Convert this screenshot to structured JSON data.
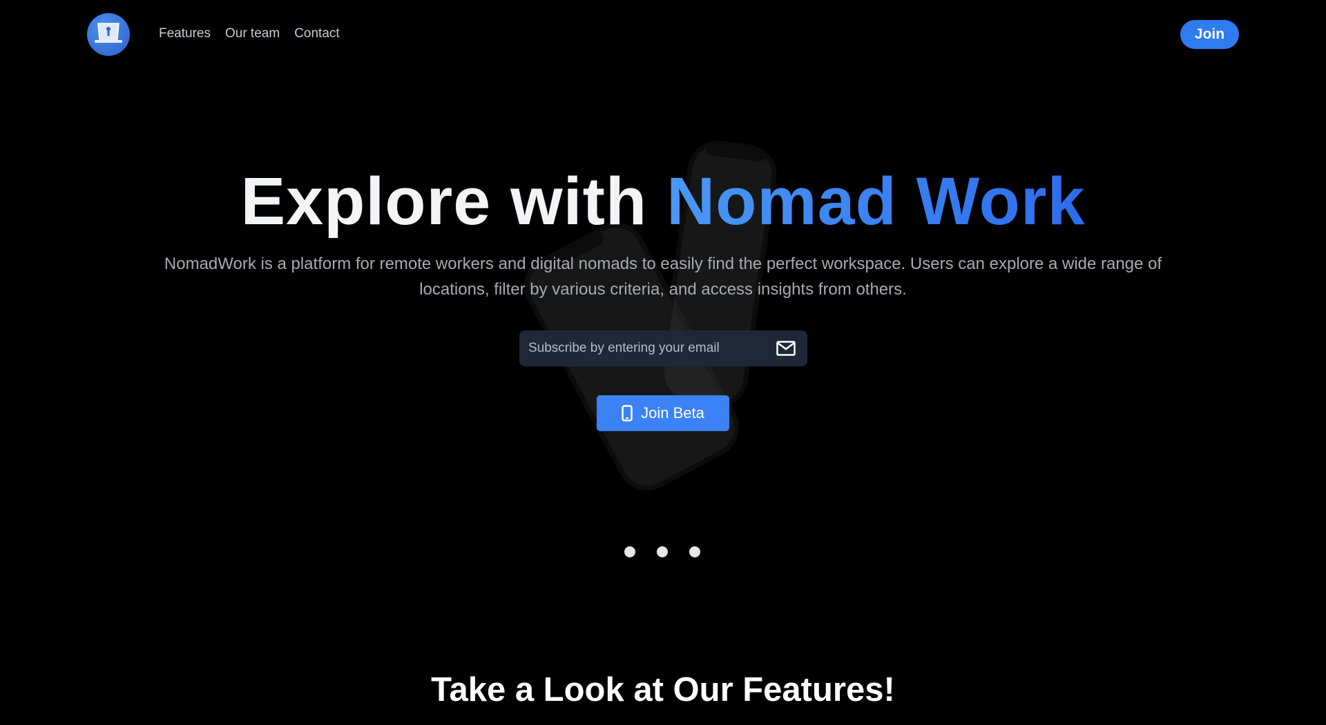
{
  "header": {
    "logo_icon": "laptop-icon",
    "nav": [
      {
        "label": "Features"
      },
      {
        "label": "Our team"
      },
      {
        "label": "Contact"
      }
    ],
    "join_label": "Join"
  },
  "hero": {
    "title_plain": "Explore with ",
    "title_accent": "Nomad Work",
    "description": "NomadWork is a platform for remote workers and digital nomads to easily find the perfect workspace. Users can explore a wide range of locations, filter by various criteria, and access insights from others.",
    "email_placeholder": "Subscribe by entering your email",
    "email_value": "",
    "join_beta_label": "Join Beta",
    "carousel_dots": 3
  },
  "features": {
    "title": "Take a Look at Our Features!"
  },
  "colors": {
    "accent": "#3b82f6",
    "background": "#000000",
    "input_bg": "#1f2838"
  }
}
